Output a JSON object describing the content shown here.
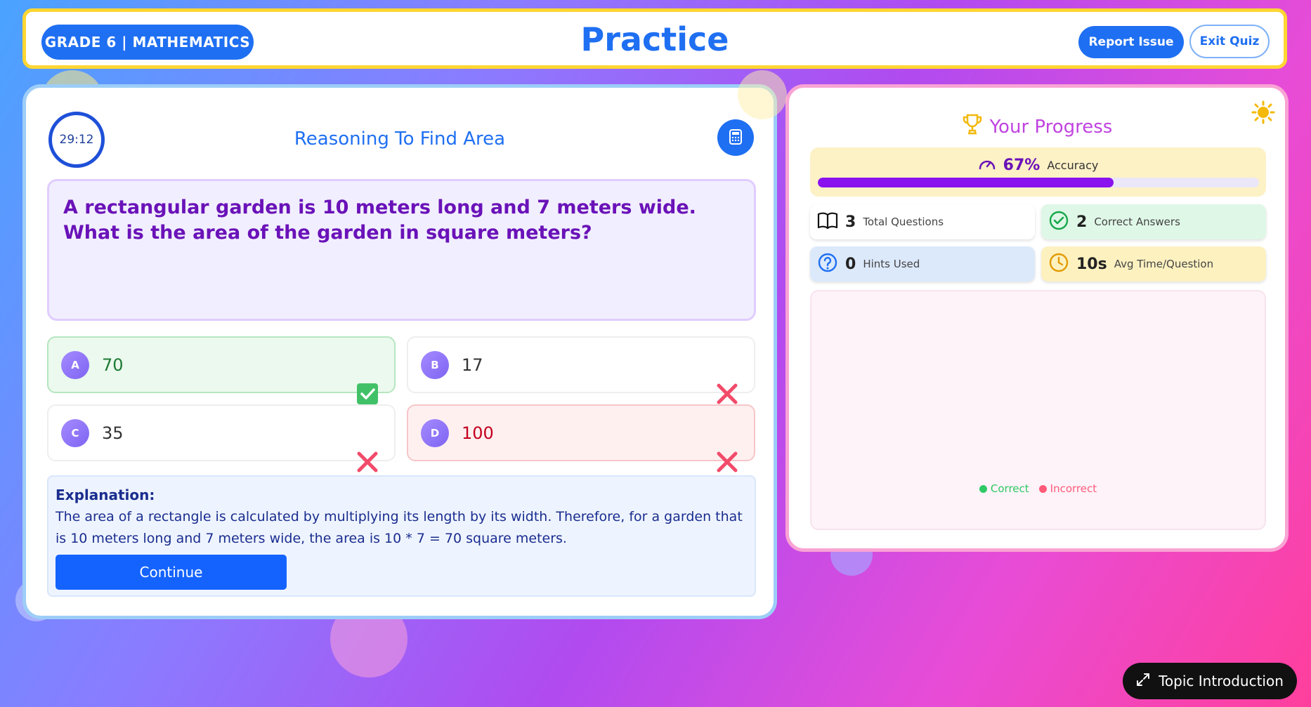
{
  "header": {
    "grade_label": "GRADE 6 | MATHEMATICS",
    "title": "Practice",
    "report_label": "Report Issue",
    "exit_label": "Exit Quiz"
  },
  "quiz": {
    "timer": "29:12",
    "title": "Reasoning To Find Area",
    "question": "A rectangular garden is 10 meters long and 7 meters wide. What is the area of the garden in square meters?",
    "options": [
      {
        "letter": "A",
        "text": "70",
        "state": "correct"
      },
      {
        "letter": "B",
        "text": "17",
        "state": "incorrect"
      },
      {
        "letter": "C",
        "text": "35",
        "state": "incorrect"
      },
      {
        "letter": "D",
        "text": "100",
        "state": "selected-incorrect"
      }
    ],
    "explanation_title": "Explanation:",
    "explanation_text": "The area of a rectangle is calculated by multiplying its length by its width. Therefore, for a garden that is 10 meters long and 7 meters wide, the area is 10 * 7 = 70 square meters.",
    "continue_label": "Continue"
  },
  "progress": {
    "title": "Your Progress",
    "accuracy_value": "67%",
    "accuracy_fraction": 0.67,
    "accuracy_label": "Accuracy",
    "stats": {
      "total": {
        "value": "3",
        "label": "Total Questions"
      },
      "correct": {
        "value": "2",
        "label": "Correct Answers"
      },
      "hints": {
        "value": "0",
        "label": "Hints Used"
      },
      "avg_time": {
        "value": "10s",
        "label": "Avg Time/Question"
      }
    },
    "legend": {
      "correct": "Correct",
      "incorrect": "Incorrect"
    }
  },
  "footer": {
    "topic_label": "Topic Introduction"
  },
  "colors": {
    "accent": "#1f6ff2",
    "correct": "#2fc965",
    "incorrect": "#ff5a7a",
    "accuracy_bar": "#8a12ee"
  },
  "icons": [
    "calculator-icon",
    "trophy-icon",
    "sun-icon",
    "gauge-icon",
    "book-icon",
    "check-circle-icon",
    "question-circle-icon",
    "clock-icon",
    "check-box-icon",
    "x-icon",
    "expand-icon"
  ]
}
